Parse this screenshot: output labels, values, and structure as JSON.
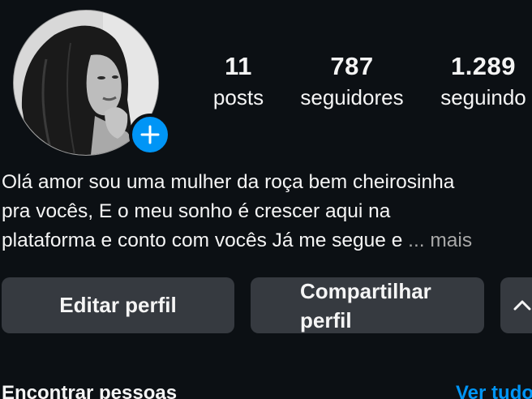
{
  "profile": {
    "stats": {
      "posts": {
        "value": "11",
        "label": "posts"
      },
      "followers": {
        "value": "787",
        "label": "seguidores"
      },
      "following": {
        "value": "1.289",
        "label": "seguindo"
      }
    },
    "bio": {
      "line1": "Olá amor sou uma mulher da roça bem cheirosinha",
      "line2": "pra vocês, E o meu sonho é crescer aqui na",
      "line3": "plataforma e conto com vocês Já me segue e",
      "more": "... mais"
    }
  },
  "actions": {
    "edit_label": "Editar perfil",
    "share_label": "Compartilhar perfil",
    "suggest_icon": "chevron-up-icon"
  },
  "discover": {
    "title": "Encontrar pessoas",
    "see_all": "Ver tudo"
  },
  "colors": {
    "background": "#0c1014",
    "button": "#363a40",
    "accent": "#0095f6",
    "text": "#f5f5f5"
  }
}
